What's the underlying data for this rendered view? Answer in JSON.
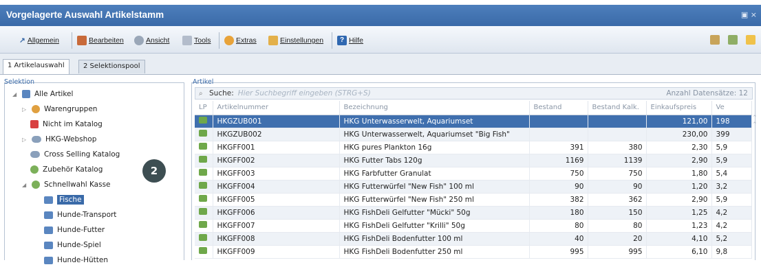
{
  "window": {
    "title": "Vorgelagerte Auswahl Artikelstamm",
    "ctrl": "▣ ×"
  },
  "toolbar": {
    "allgemein": "Allgemein",
    "bearbeiten": "Bearbeiten",
    "ansicht": "Ansicht",
    "tools": "Tools",
    "extras": "Extras",
    "einstellungen": "Einstellungen",
    "hilfe": "Hilfe"
  },
  "tabs": [
    "1 Artikelauswahl",
    "2 Selektionspool"
  ],
  "left": {
    "header": "Selektion",
    "items": [
      "Alle Artikel",
      "Warengruppen",
      "Nicht im Katalog",
      "HKG-Webshop",
      "Cross Selling Katalog",
      "Zubehör Katalog",
      "Schnellwahl Kasse",
      "Fische",
      "Hunde-Transport",
      "Hunde-Futter",
      "Hunde-Spiel",
      "Hunde-Hütten"
    ],
    "badge": "2"
  },
  "right": {
    "header": "Artikel",
    "search_label": "Suche:",
    "search_placeholder": "Hier Suchbegriff eingeben (STRG+S)",
    "count": "Anzahl Datensätze: 12"
  },
  "table": {
    "columns": [
      "LP",
      "Artikelnummer",
      "Bezeichnung",
      "Bestand",
      "Bestand Kalk.",
      "Einkaufspreis",
      "Ve"
    ],
    "rows": [
      [
        "HKGZUB001",
        "HKG Unterwasserwelt, Aquariumset",
        "",
        "",
        "121,00",
        "198"
      ],
      [
        "HKGZUB002",
        "HKG Unterwasserwelt, Aquariumset \"Big Fish\"",
        "",
        "",
        "230,00",
        "399"
      ],
      [
        "HKGFF001",
        "HKG pures Plankton 16g",
        "391",
        "380",
        "2,30",
        "5,9"
      ],
      [
        "HKGFF002",
        "HKG Futter Tabs 120g",
        "1169",
        "1139",
        "2,90",
        "5,9"
      ],
      [
        "HKGFF003",
        "HKG Farbfutter Granulat",
        "750",
        "750",
        "1,80",
        "5,4"
      ],
      [
        "HKGFF004",
        "HKG Futterwürfel \"New Fish\" 100 ml",
        "90",
        "90",
        "1,20",
        "3,2"
      ],
      [
        "HKGFF005",
        "HKG Futterwürfel \"New Fish\" 250 ml",
        "382",
        "362",
        "2,90",
        "5,9"
      ],
      [
        "HKGFF006",
        "HKG FishDeli Gelfutter \"Mücki\" 50g",
        "180",
        "150",
        "1,25",
        "4,2"
      ],
      [
        "HKGFF007",
        "HKG FishDeli Gelfutter \"Krilli\" 50g",
        "80",
        "80",
        "1,23",
        "4,2"
      ],
      [
        "HKGFF008",
        "HKG FishDeli Bodenfutter 100 ml",
        "40",
        "20",
        "4,10",
        "5,2"
      ],
      [
        "HKGFF009",
        "HKG FishDeli Bodenfutter 250 ml",
        "995",
        "995",
        "6,10",
        "9,8"
      ]
    ]
  }
}
